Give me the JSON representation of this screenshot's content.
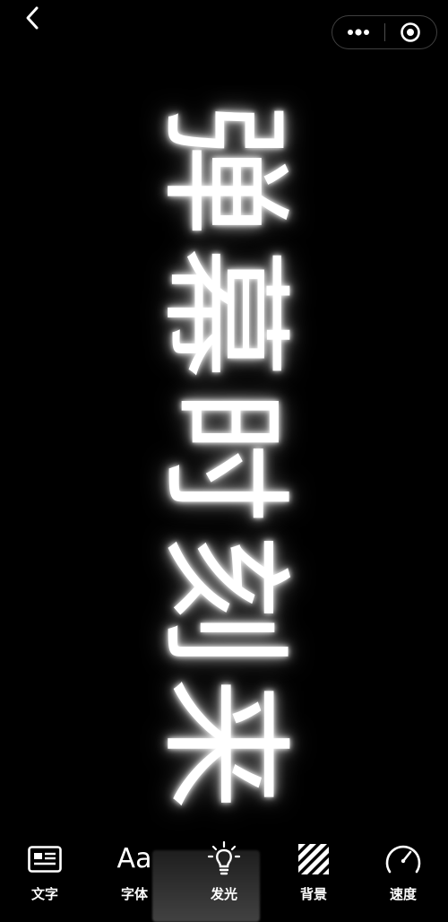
{
  "danmaku": {
    "text": "弹幕时刻来"
  },
  "nav": {
    "back_icon": "chevron-left-icon",
    "more_icon": "more-dots-icon",
    "record_icon": "target-circle-icon"
  },
  "toolbar": {
    "items": [
      {
        "label": "文字",
        "icon": "text-card-icon"
      },
      {
        "label": "字体",
        "icon": "font-aa-icon",
        "glyph": "Aa"
      },
      {
        "label": "发光",
        "icon": "lightbulb-icon"
      },
      {
        "label": "背景",
        "icon": "stripes-pattern-icon"
      },
      {
        "label": "速度",
        "icon": "speedometer-icon"
      }
    ]
  },
  "colors": {
    "background": "#000000",
    "foreground": "#ffffff"
  }
}
